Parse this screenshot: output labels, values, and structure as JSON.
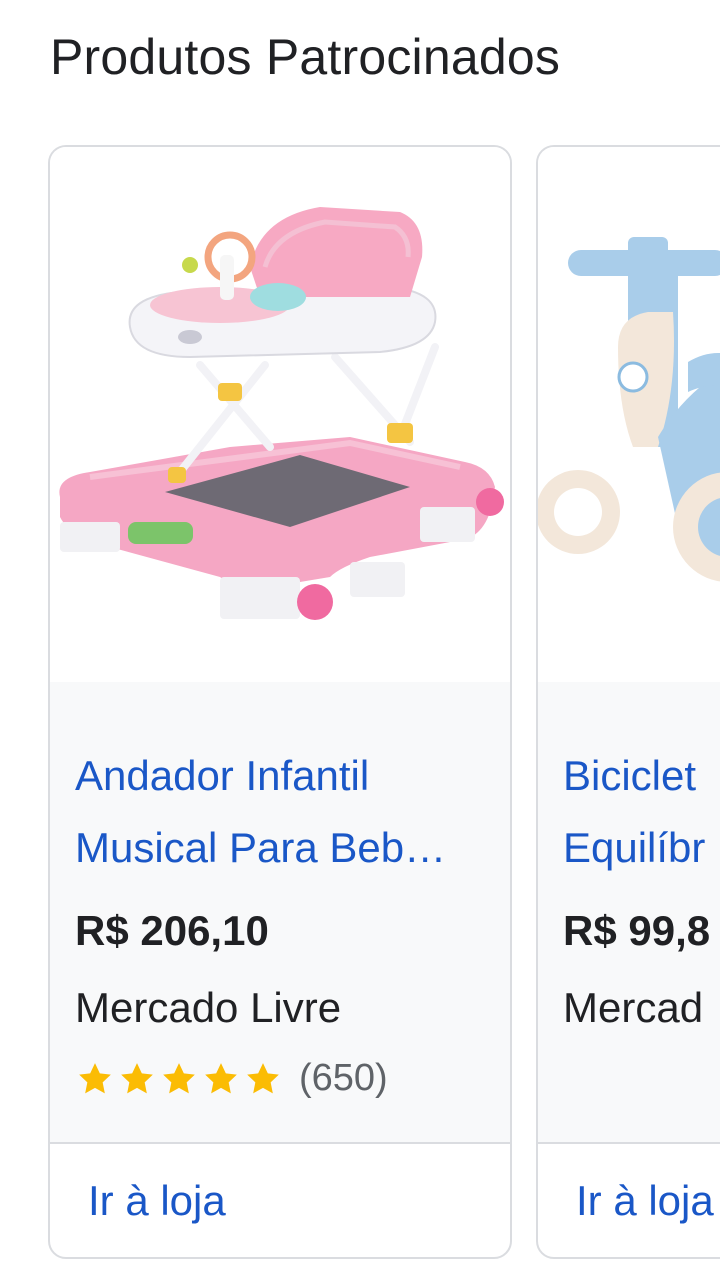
{
  "section": {
    "title": "Produtos Patrocinados"
  },
  "products": [
    {
      "title_line1": "Andador Infantil",
      "title_line2": "Musical Para Beb…",
      "price": "R$ 206,10",
      "seller": "Mercado Livre",
      "rating_stars": 5,
      "rating_count": "(650)",
      "store_link": "Ir à loja"
    },
    {
      "title_line1": "Biciclet",
      "title_line2": "Equilíbr",
      "price": "R$ 99,8",
      "seller": "Mercad",
      "store_link": "Ir à loja"
    }
  ],
  "colors": {
    "link_blue": "#1a57c7",
    "star_yellow": "#fbbc04",
    "text_dark": "#202124",
    "border": "#dadce0"
  }
}
